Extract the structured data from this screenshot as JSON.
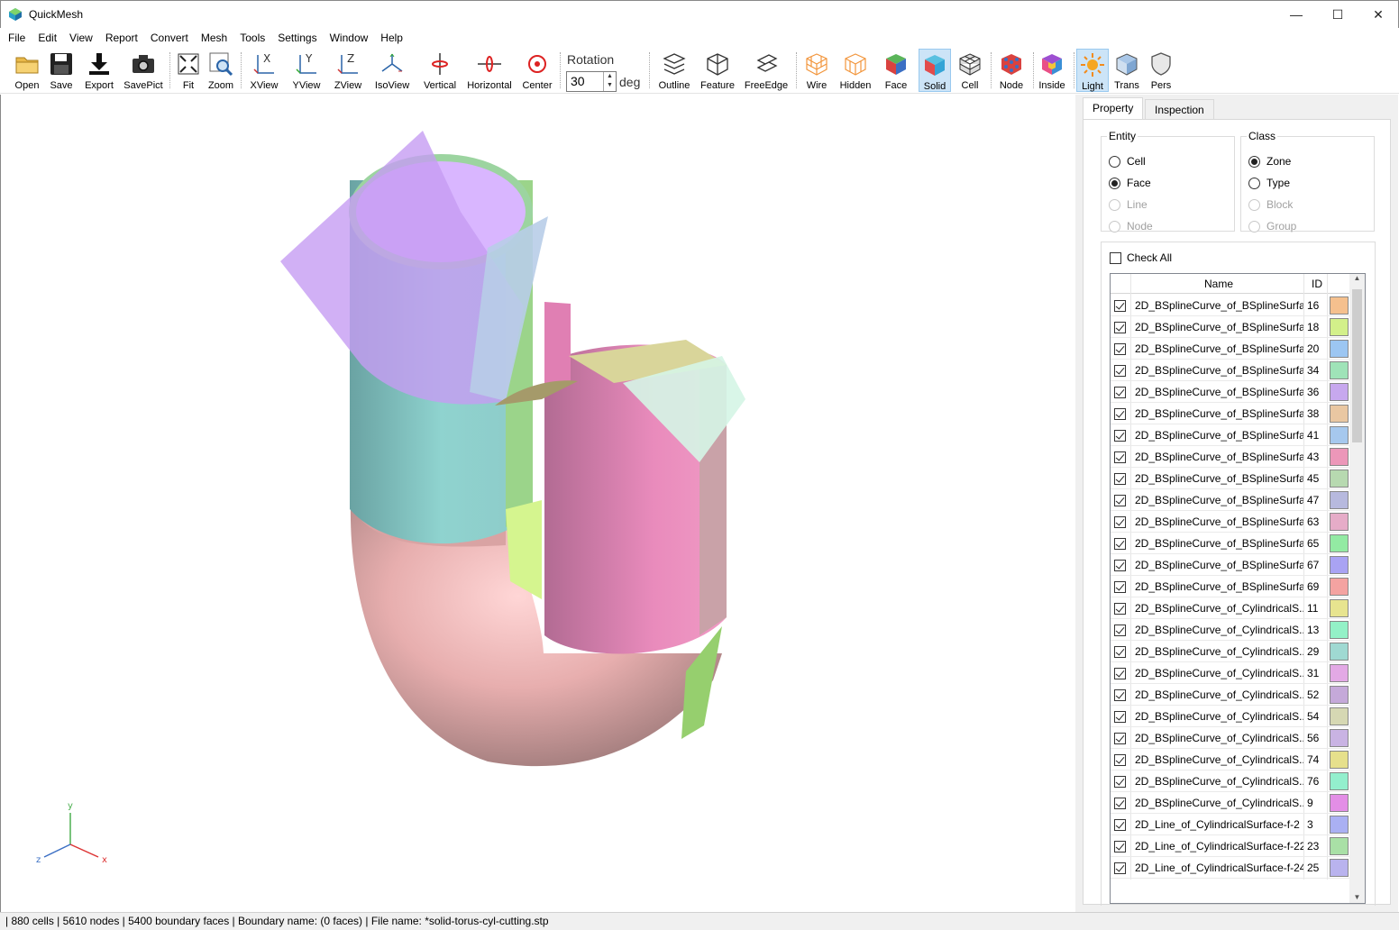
{
  "window": {
    "title": "QuickMesh",
    "min": "—",
    "max": "☐",
    "close": "✕"
  },
  "menu": [
    "File",
    "Edit",
    "View",
    "Report",
    "Convert",
    "Mesh",
    "Tools",
    "Settings",
    "Window",
    "Help"
  ],
  "toolbar": {
    "open": "Open",
    "save": "Save",
    "export": "Export",
    "savepict": "SavePict",
    "fit": "Fit",
    "zoom": "Zoom",
    "xview": "XView",
    "yview": "YView",
    "zview": "ZView",
    "isoview": "IsoView",
    "vertical": "Vertical",
    "horizontal": "Horizontal",
    "center": "Center",
    "rotation_label": "Rotation",
    "rotation_value": "30",
    "rotation_unit": "deg",
    "outline": "Outline",
    "feature": "Feature",
    "freeedge": "FreeEdge",
    "wire": "Wire",
    "hidden": "Hidden",
    "face": "Face",
    "solid": "Solid",
    "cell": "Cell",
    "node": "Node",
    "inside": "Inside",
    "light": "Light",
    "trans": "Trans",
    "pers": "Pers",
    "active": [
      "solid",
      "light"
    ]
  },
  "axes": {
    "x": "x",
    "y": "y",
    "z": "z"
  },
  "panel": {
    "tabs": [
      "Property",
      "Inspection"
    ],
    "entity": {
      "title": "Entity",
      "options": [
        {
          "label": "Cell",
          "checked": false,
          "enabled": true
        },
        {
          "label": "Face",
          "checked": true,
          "enabled": true
        },
        {
          "label": "Line",
          "checked": false,
          "enabled": false
        },
        {
          "label": "Node",
          "checked": false,
          "enabled": false
        }
      ]
    },
    "class": {
      "title": "Class",
      "options": [
        {
          "label": "Zone",
          "checked": true,
          "enabled": true
        },
        {
          "label": "Type",
          "checked": false,
          "enabled": true
        },
        {
          "label": "Block",
          "checked": false,
          "enabled": false
        },
        {
          "label": "Group",
          "checked": false,
          "enabled": false
        }
      ]
    },
    "check_all": "Check All",
    "columns": {
      "name": "Name",
      "id": "ID"
    },
    "rows": [
      {
        "name": "2D_BSplineCurve_of_BSplineSurfa...",
        "id": "16",
        "color": "#f5c08e"
      },
      {
        "name": "2D_BSplineCurve_of_BSplineSurfa...",
        "id": "18",
        "color": "#d3f08a"
      },
      {
        "name": "2D_BSplineCurve_of_BSplineSurfa...",
        "id": "20",
        "color": "#9cc6f2"
      },
      {
        "name": "2D_BSplineCurve_of_BSplineSurfa...",
        "id": "34",
        "color": "#9fe3b8"
      },
      {
        "name": "2D_BSplineCurve_of_BSplineSurfa...",
        "id": "36",
        "color": "#c7a8ee"
      },
      {
        "name": "2D_BSplineCurve_of_BSplineSurfa...",
        "id": "38",
        "color": "#e9c7a2"
      },
      {
        "name": "2D_BSplineCurve_of_BSplineSurfa...",
        "id": "41",
        "color": "#a6c8ee"
      },
      {
        "name": "2D_BSplineCurve_of_BSplineSurfa...",
        "id": "43",
        "color": "#ec97b9"
      },
      {
        "name": "2D_BSplineCurve_of_BSplineSurfa...",
        "id": "45",
        "color": "#b7d9b0"
      },
      {
        "name": "2D_BSplineCurve_of_BSplineSurfa...",
        "id": "47",
        "color": "#b7b9de"
      },
      {
        "name": "2D_BSplineCurve_of_BSplineSurfa...",
        "id": "63",
        "color": "#e6acc8"
      },
      {
        "name": "2D_BSplineCurve_of_BSplineSurfa...",
        "id": "65",
        "color": "#93eaa3"
      },
      {
        "name": "2D_BSplineCurve_of_BSplineSurfa...",
        "id": "67",
        "color": "#a9a3f3"
      },
      {
        "name": "2D_BSplineCurve_of_BSplineSurfa...",
        "id": "69",
        "color": "#f4a3a1"
      },
      {
        "name": "2D_BSplineCurve_of_CylindricalS...",
        "id": "11",
        "color": "#e7e48f"
      },
      {
        "name": "2D_BSplineCurve_of_CylindricalS...",
        "id": "13",
        "color": "#93f1c7"
      },
      {
        "name": "2D_BSplineCurve_of_CylindricalS...",
        "id": "29",
        "color": "#9fd9d2"
      },
      {
        "name": "2D_BSplineCurve_of_CylindricalS...",
        "id": "31",
        "color": "#e3a9e5"
      },
      {
        "name": "2D_BSplineCurve_of_CylindricalS...",
        "id": "52",
        "color": "#c5a9d9"
      },
      {
        "name": "2D_BSplineCurve_of_CylindricalS...",
        "id": "54",
        "color": "#d6d8b3"
      },
      {
        "name": "2D_BSplineCurve_of_CylindricalS...",
        "id": "56",
        "color": "#c9b3e3"
      },
      {
        "name": "2D_BSplineCurve_of_CylindricalS...",
        "id": "74",
        "color": "#e6e08c"
      },
      {
        "name": "2D_BSplineCurve_of_CylindricalS...",
        "id": "76",
        "color": "#93efcd"
      },
      {
        "name": "2D_BSplineCurve_of_CylindricalS...",
        "id": "9",
        "color": "#e38ee6"
      },
      {
        "name": "2D_Line_of_CylindricalSurface-f-2",
        "id": "3",
        "color": "#aab0f3"
      },
      {
        "name": "2D_Line_of_CylindricalSurface-f-22",
        "id": "23",
        "color": "#a9e0a6"
      },
      {
        "name": "2D_Line_of_CylindricalSurface-f-24",
        "id": "25",
        "color": "#b9b3ee"
      }
    ]
  },
  "status": "| 880 cells | 5610 nodes | 5400 boundary faces |  Boundary name:  (0 faces) | File name: *solid-torus-cyl-cutting.stp"
}
